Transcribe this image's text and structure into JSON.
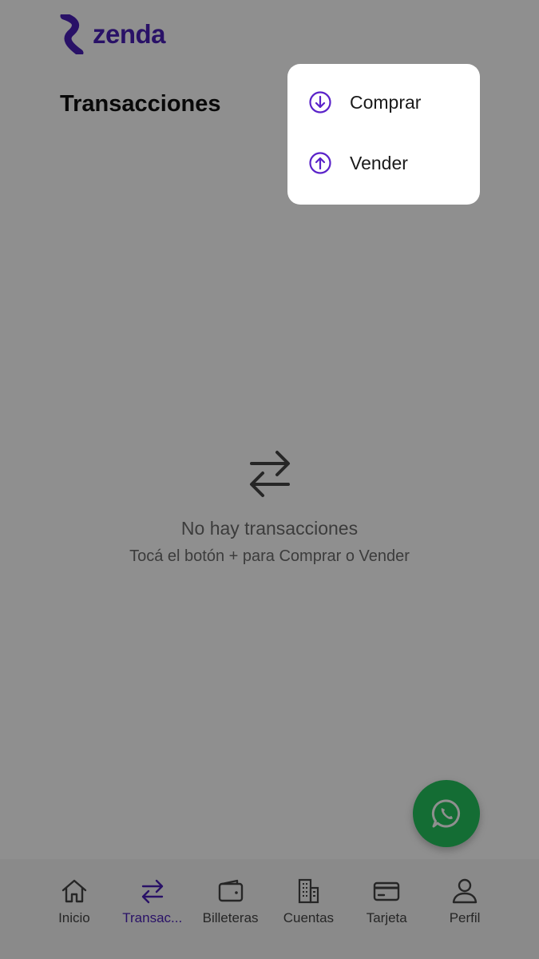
{
  "brand": {
    "name": "zenda",
    "accent": "#4a1fb8"
  },
  "header": {
    "title": "Transacciones"
  },
  "empty_state": {
    "icon": "arrows-swap-icon",
    "title": "No hay transacciones",
    "subtitle": "Tocá el botón + para Comprar o Vender"
  },
  "menu": {
    "items": [
      {
        "label": "Comprar",
        "icon": "arrow-down-circle-icon"
      },
      {
        "label": "Vender",
        "icon": "arrow-up-circle-icon"
      }
    ]
  },
  "fab": {
    "icon": "whatsapp-icon",
    "color": "#25c25e"
  },
  "tabbar": {
    "active": "Transac...",
    "items": [
      {
        "label": "Inicio",
        "icon": "home-icon"
      },
      {
        "label": "Transac...",
        "icon": "arrows-swap-icon"
      },
      {
        "label": "Billeteras",
        "icon": "wallet-icon"
      },
      {
        "label": "Cuentas",
        "icon": "building-icon"
      },
      {
        "label": "Tarjeta",
        "icon": "card-icon"
      },
      {
        "label": "Perfil",
        "icon": "user-icon"
      }
    ]
  }
}
